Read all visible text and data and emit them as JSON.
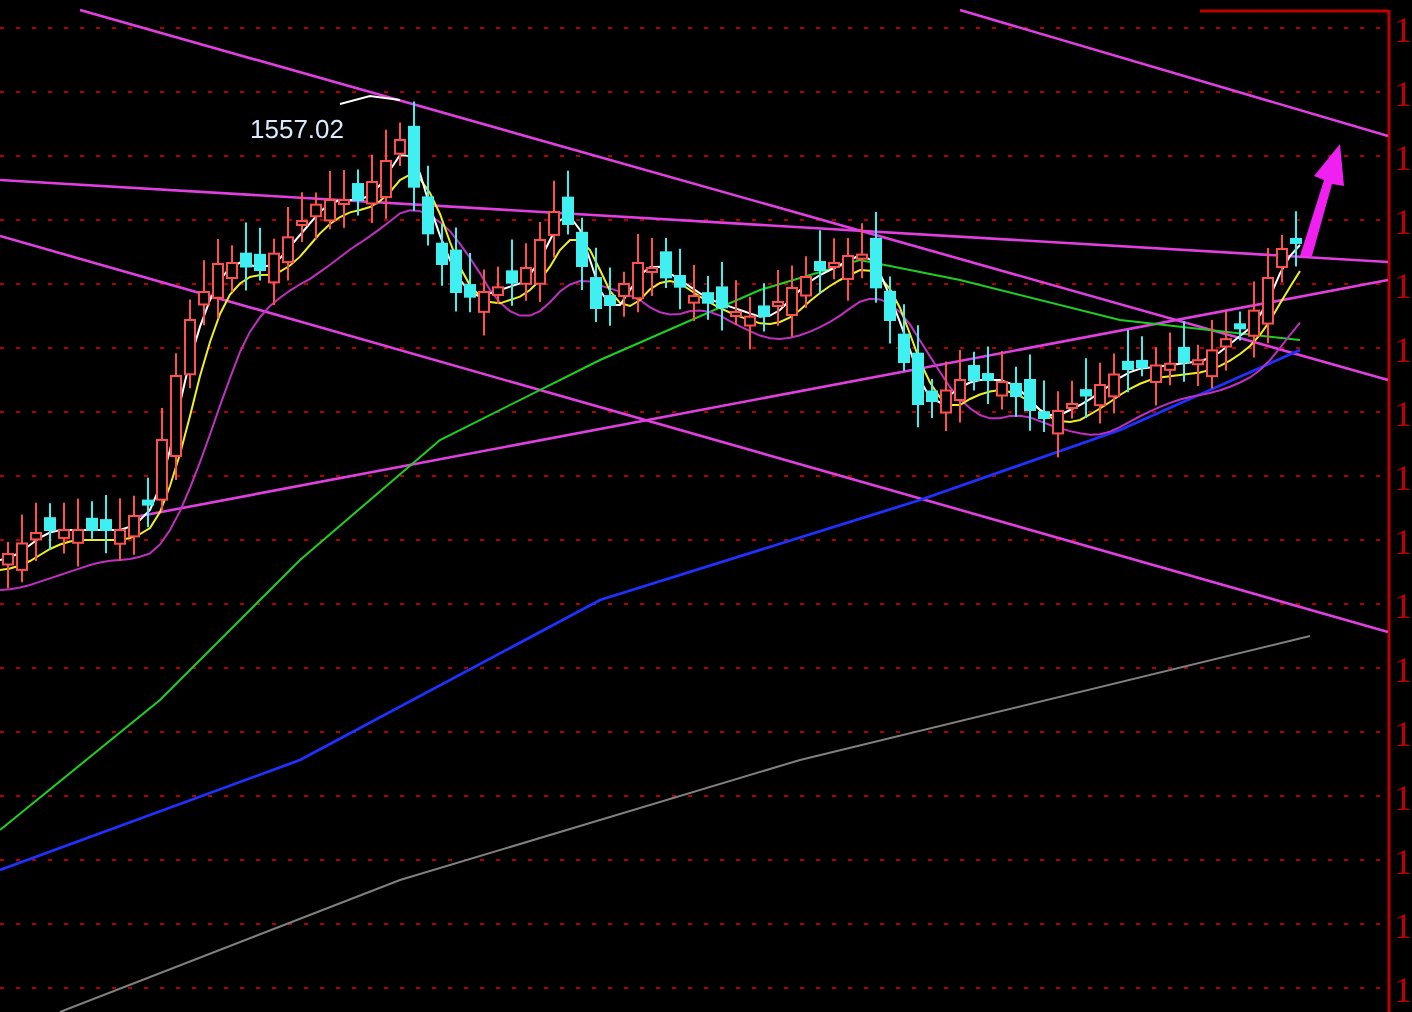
{
  "chart": {
    "peak_label": "1557.02",
    "axis_labels": [
      "1",
      "1",
      "1",
      "1",
      "1",
      "1",
      "1",
      "1",
      "1",
      "1",
      "1",
      "1",
      "1",
      "1",
      "1",
      "1"
    ]
  }
}
